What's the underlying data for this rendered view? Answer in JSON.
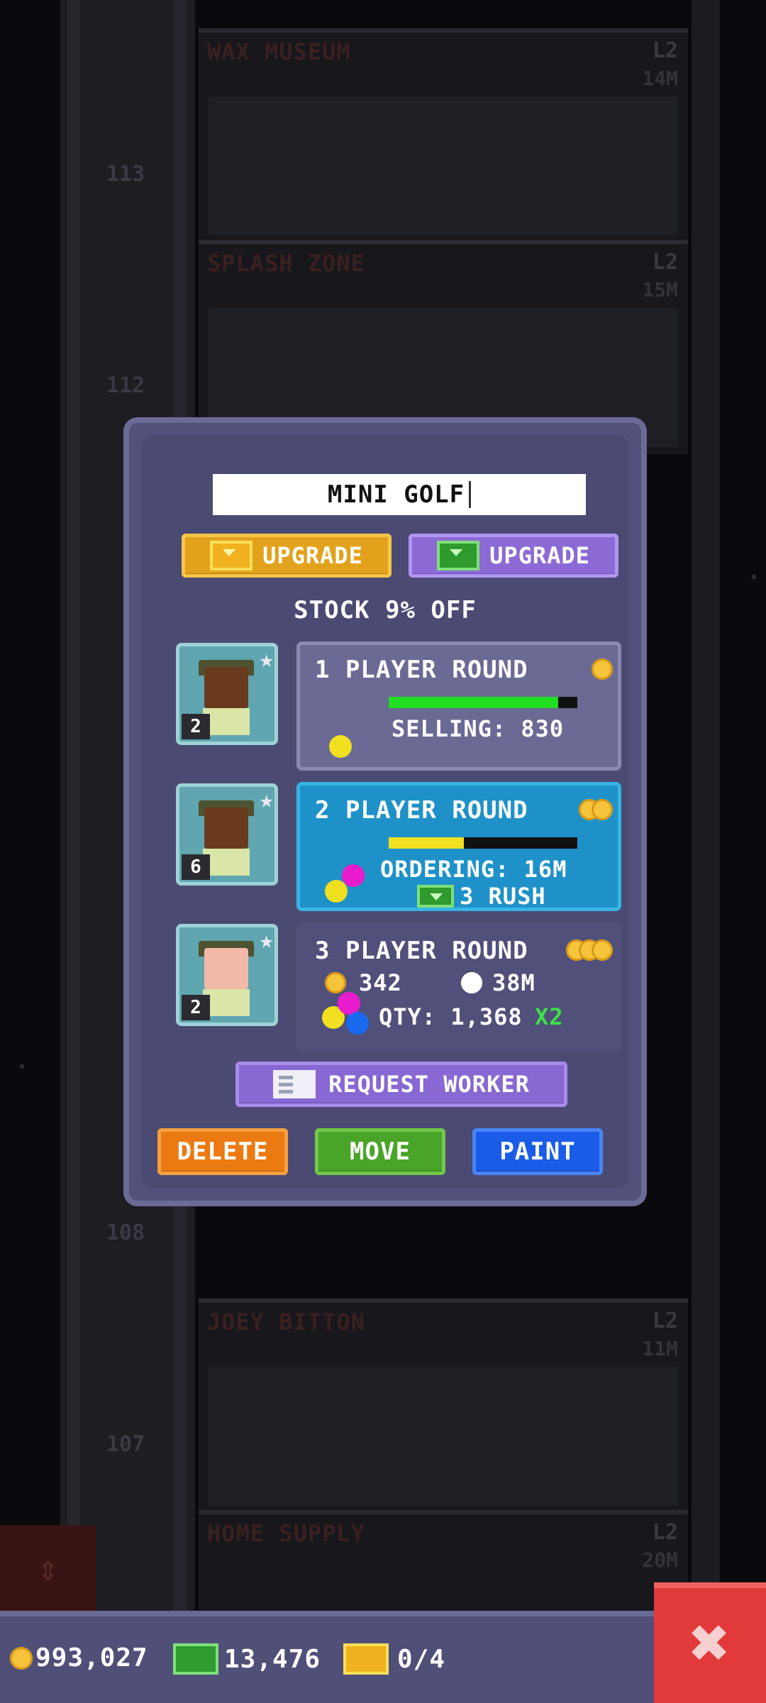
{
  "background": {
    "floor_numbers": [
      "113",
      "112",
      "108",
      "107"
    ],
    "floors": [
      {
        "name": "WAX MUSEUM",
        "level": "L2",
        "money": "14M"
      },
      {
        "name": "SPLASH ZONE",
        "level": "L2",
        "money": "15M"
      },
      {
        "name": "JOEY BITTON",
        "level": "L2",
        "money": "11M"
      },
      {
        "name": "HOME SUPPLY",
        "level": "L2",
        "money": "20M"
      }
    ]
  },
  "dialog": {
    "name_value": "MINI GOLF",
    "upgrade_bux_label": "UPGRADE",
    "upgrade_cash_label": "UPGRADE",
    "stock_discount": "STOCK 9% OFF",
    "products": [
      {
        "title": "1 PLAYER ROUND",
        "status": "SELLING: 830",
        "worker_level": "2",
        "progress": 0.9,
        "coins": 1
      },
      {
        "title": "2 PLAYER ROUND",
        "status": "ORDERING: 16M",
        "rush": "3 RUSH",
        "worker_level": "6",
        "progress": 0.4,
        "coins": 2
      },
      {
        "title": "3 PLAYER ROUND",
        "price": "342",
        "time": "38M",
        "qty": "QTY: 1,368",
        "multiplier": "X2",
        "worker_level": "2",
        "coins": 3
      }
    ],
    "request_worker_label": "REQUEST WORKER",
    "delete_label": "DELETE",
    "move_label": "MOVE",
    "paint_label": "PAINT"
  },
  "status_bar": {
    "coins": "993,027",
    "bux": "13,476",
    "bux_tickets": "0/4"
  },
  "colors": {
    "dialog_bg": "#51517b",
    "active_round": "#1e92c8",
    "progress_green": "#22dd22",
    "progress_yellow": "#f0e020",
    "delete": "#ec7a12",
    "move": "#4aa428",
    "paint": "#1a5ce8",
    "close": "#e23a3a"
  },
  "icons": [
    "bux-icon",
    "cash-icon",
    "coin-icon",
    "clock-icon",
    "star-icon",
    "envelope-icon",
    "close-icon",
    "elevator-arrows-icon"
  ]
}
